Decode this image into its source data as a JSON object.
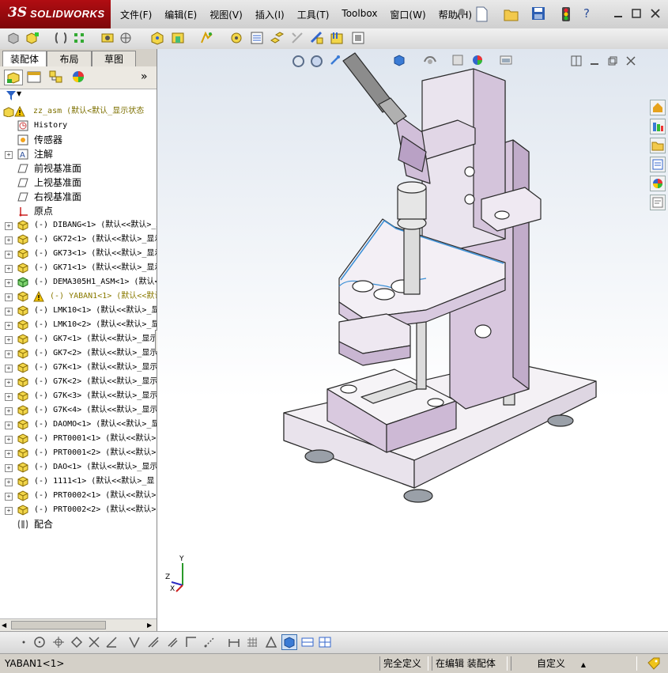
{
  "app": {
    "logo_ds": "3S",
    "logo_text": "SOLIDWORKS"
  },
  "menu": [
    "文件(F)",
    "编辑(E)",
    "视图(V)",
    "插入(I)",
    "工具(T)",
    "Toolbox",
    "窗口(W)",
    "帮助(H)"
  ],
  "panel": {
    "tabs": [
      "装配体",
      "布局",
      "草图"
    ],
    "expand_glyph": "»",
    "filter_glyph": "▼"
  },
  "tree": [
    {
      "label": "zz_asm  (默认<默认_显示状态",
      "icon": "assembly-warning-icon",
      "expand": "",
      "indent": 0,
      "type": "root"
    },
    {
      "label": "History",
      "icon": "history-icon",
      "expand": "",
      "indent": 1,
      "type": "mono"
    },
    {
      "label": "传感器",
      "icon": "sensor-icon",
      "expand": "",
      "indent": 1,
      "type": "cn"
    },
    {
      "label": "注解",
      "icon": "annotation-icon",
      "expand": "+",
      "indent": 1,
      "type": "cn"
    },
    {
      "label": "前视基准面",
      "icon": "plane-icon",
      "expand": "",
      "indent": 1,
      "type": "cn"
    },
    {
      "label": "上视基准面",
      "icon": "plane-icon",
      "expand": "",
      "indent": 1,
      "type": "cn"
    },
    {
      "label": "右视基准面",
      "icon": "plane-icon",
      "expand": "",
      "indent": 1,
      "type": "cn"
    },
    {
      "label": "原点",
      "icon": "origin-icon",
      "expand": "",
      "indent": 1,
      "type": "cn"
    },
    {
      "label": "(-) DIBANG<1> (默认<<默认>_显",
      "icon": "part-icon",
      "expand": "+",
      "indent": 1,
      "type": "mono"
    },
    {
      "label": "(-) GK72<1> (默认<<默认>_显示",
      "icon": "part-icon",
      "expand": "+",
      "indent": 1,
      "type": "mono"
    },
    {
      "label": "(-) GK73<1> (默认<<默认>_显示",
      "icon": "part-icon",
      "expand": "+",
      "indent": 1,
      "type": "mono"
    },
    {
      "label": "(-) GK71<1> (默认<<默认>_显示",
      "icon": "part-icon",
      "expand": "+",
      "indent": 1,
      "type": "mono"
    },
    {
      "label": "(-) DEMA305H1_ASM<1> (默认<",
      "icon": "subassembly-icon",
      "expand": "+",
      "indent": 1,
      "type": "mono"
    },
    {
      "label": "(-) YABAN1<1> (默认<<默认>",
      "icon": "warning-icon",
      "expand": "+",
      "indent": 1,
      "type": "mono-warn"
    },
    {
      "label": "(-) LMK10<1> (默认<<默认>_显",
      "icon": "part-icon",
      "expand": "+",
      "indent": 1,
      "type": "mono"
    },
    {
      "label": "(-) LMK10<2> (默认<<默认>_显",
      "icon": "part-icon",
      "expand": "+",
      "indent": 1,
      "type": "mono"
    },
    {
      "label": "(-) GK7<1> (默认<<默认>_显示",
      "icon": "part-icon",
      "expand": "+",
      "indent": 1,
      "type": "mono"
    },
    {
      "label": "(-) GK7<2> (默认<<默认>_显示",
      "icon": "part-icon",
      "expand": "+",
      "indent": 1,
      "type": "mono"
    },
    {
      "label": "(-) G7K<1> (默认<<默认>_显示",
      "icon": "part-icon",
      "expand": "+",
      "indent": 1,
      "type": "mono"
    },
    {
      "label": "(-) G7K<2> (默认<<默认>_显示",
      "icon": "part-icon",
      "expand": "+",
      "indent": 1,
      "type": "mono"
    },
    {
      "label": "(-) G7K<3> (默认<<默认>_显示",
      "icon": "part-icon",
      "expand": "+",
      "indent": 1,
      "type": "mono"
    },
    {
      "label": "(-) G7K<4> (默认<<默认>_显示",
      "icon": "part-icon",
      "expand": "+",
      "indent": 1,
      "type": "mono"
    },
    {
      "label": "(-) DAOMO<1> (默认<<默认>_显",
      "icon": "part-icon",
      "expand": "+",
      "indent": 1,
      "type": "mono"
    },
    {
      "label": "(-) PRT0001<1> (默认<<默认>",
      "icon": "part-icon",
      "expand": "+",
      "indent": 1,
      "type": "mono"
    },
    {
      "label": "(-) PRT0001<2> (默认<<默认>",
      "icon": "part-icon",
      "expand": "+",
      "indent": 1,
      "type": "mono"
    },
    {
      "label": "(-) DAO<1> (默认<<默认>_显示",
      "icon": "part-icon",
      "expand": "+",
      "indent": 1,
      "type": "mono"
    },
    {
      "label": "(-) 1111<1> (默认<<默认>_显",
      "icon": "part-icon",
      "expand": "+",
      "indent": 1,
      "type": "mono"
    },
    {
      "label": "(-) PRT0002<1> (默认<<默认>",
      "icon": "part-icon",
      "expand": "+",
      "indent": 1,
      "type": "mono"
    },
    {
      "label": "(-) PRT0002<2> (默认<<默认>",
      "icon": "part-icon",
      "expand": "+",
      "indent": 1,
      "type": "mono"
    },
    {
      "label": "配合",
      "icon": "mates-icon",
      "expand": "",
      "indent": 1,
      "type": "cn"
    }
  ],
  "triad": {
    "x": "X",
    "y": "Y",
    "z": "Z"
  },
  "status": {
    "selected": "YABAN1<1>",
    "defined": "完全定义",
    "editing": "在编辑 装配体",
    "units": "自定义",
    "units_arrow": "▲"
  },
  "colors": {
    "part_face": "#e6dcec",
    "part_edge": "#2a2a2a",
    "selection": "#3a8fd6",
    "brand": "#b10d12"
  }
}
